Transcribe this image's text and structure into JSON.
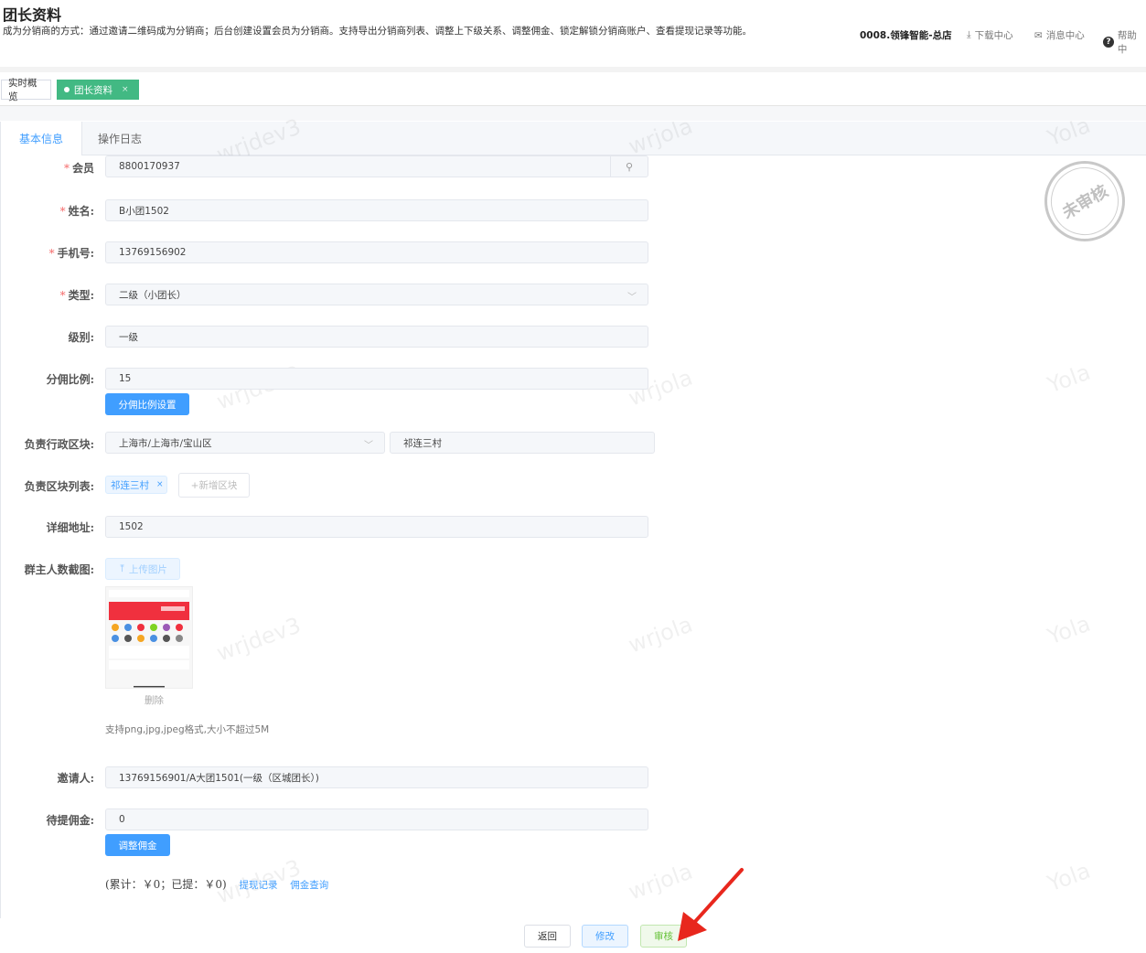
{
  "header": {
    "title": "团长资料",
    "description": "成为分销商的方式：通过邀请二维码成为分销商；后台创建设置会员为分销商。支持导出分销商列表、调整上下级关系、调整佣金、锁定解锁分销商账户、查看提现记录等功能。",
    "store": "0008.领锋智能-总店",
    "download": "下载中心",
    "messages": "消息中心",
    "help": "帮助中"
  },
  "tags": {
    "overview": "实时概览",
    "active": "团长资料"
  },
  "tabs": {
    "basic": "基本信息",
    "log": "操作日志"
  },
  "form": {
    "member": {
      "label": "会员",
      "value": "8800170937"
    },
    "name": {
      "label": "姓名:",
      "value": "B小团1502"
    },
    "phone": {
      "label": "手机号:",
      "value": "13769156902"
    },
    "type": {
      "label": "类型:",
      "value": "二级（小团长）"
    },
    "level": {
      "label": "级别:",
      "value": "一级"
    },
    "ratio": {
      "label": "分佣比例:",
      "value": "15",
      "button": "分佣比例设置"
    },
    "region": {
      "label": "负责行政区块:",
      "value": "上海市/上海市/宝山区",
      "village": "祁连三村"
    },
    "blocks": {
      "label": "负责区块列表:",
      "chip": "祁连三村",
      "add": "+新增区块"
    },
    "address": {
      "label": "详细地址:",
      "value": "1502"
    },
    "screenshot": {
      "label": "群主人数截图:",
      "upload": "上传图片",
      "delete": "删除",
      "hint": "支持png,jpg,jpeg格式,大小不超过5M"
    },
    "inviter": {
      "label": "邀请人:",
      "value": "13769156901/A大团1501(一级（区城团长）)"
    },
    "commission": {
      "label": "待提佣金:",
      "value": "0",
      "button": "调整佣金"
    },
    "summary": {
      "text": "(累计：￥0；已提：￥0)",
      "withdraw_link": "提现记录",
      "commission_link": "佣金查询"
    }
  },
  "stamp": "未审核",
  "buttons": {
    "back": "返回",
    "edit": "修改",
    "audit": "审核"
  },
  "watermarks": [
    "wrjdev3",
    "Yola",
    "wrjdev3",
    "wrjola",
    "Yola",
    "wrjdev3",
    "wrjola",
    "Yola",
    "wrjdev3",
    "wrjola",
    "Yola",
    "wrjdev3",
    "wrjola"
  ]
}
